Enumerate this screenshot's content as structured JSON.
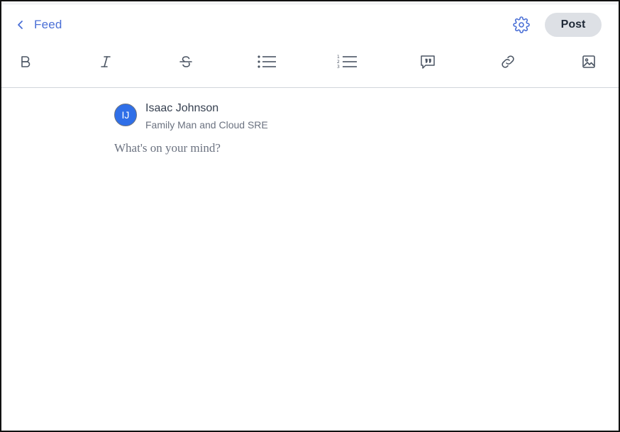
{
  "header": {
    "back_label": "Feed",
    "post_label": "Post"
  },
  "toolbar": {
    "tools": [
      {
        "name": "bold",
        "icon": "bold-icon"
      },
      {
        "name": "italic",
        "icon": "italic-icon"
      },
      {
        "name": "strikethrough",
        "icon": "strikethrough-icon"
      },
      {
        "name": "bulleted-list",
        "icon": "bulleted-list-icon"
      },
      {
        "name": "numbered-list",
        "icon": "numbered-list-icon"
      },
      {
        "name": "quote",
        "icon": "quote-icon"
      },
      {
        "name": "link",
        "icon": "link-icon"
      },
      {
        "name": "image",
        "icon": "image-icon"
      }
    ]
  },
  "author": {
    "initials": "IJ",
    "name": "Isaac Johnson",
    "headline": "Family Man and Cloud SRE"
  },
  "editor": {
    "placeholder": "What's on your mind?"
  },
  "colors": {
    "accent": "#4a6fd6",
    "avatar": "#2f6fe8",
    "post_button_bg": "#dde0e5",
    "icon": "#4b5563"
  }
}
